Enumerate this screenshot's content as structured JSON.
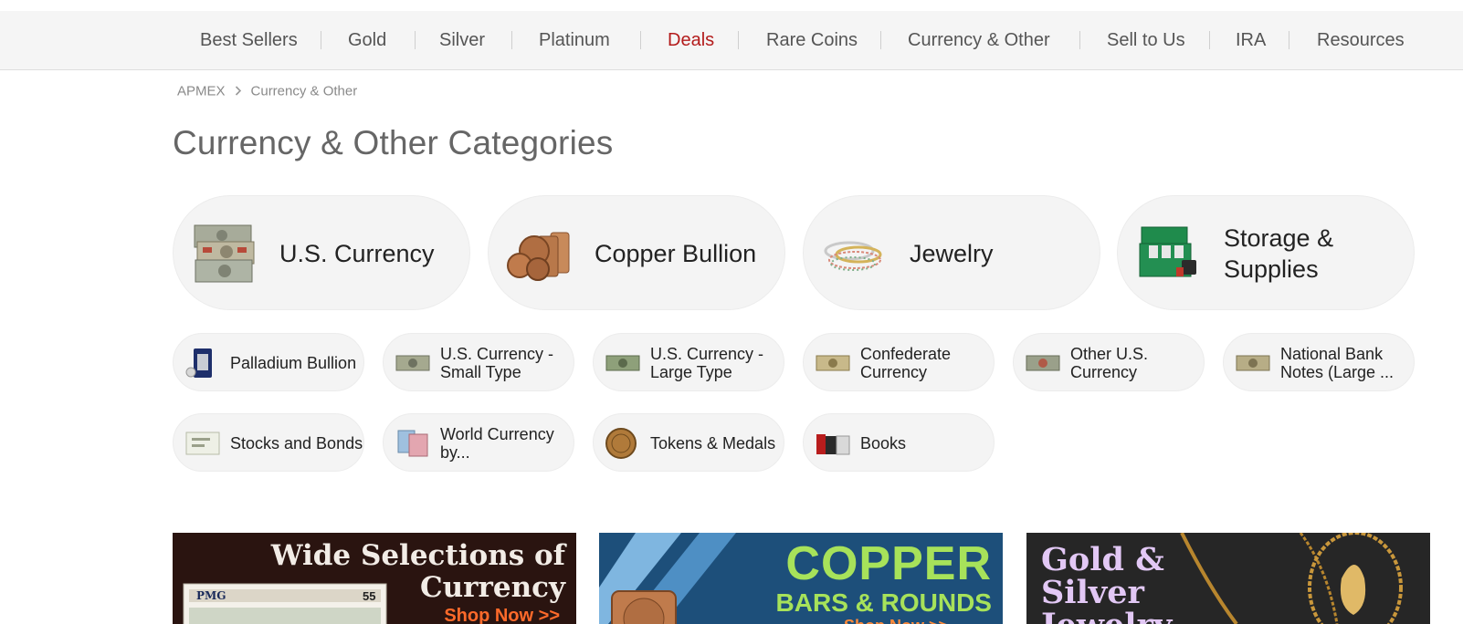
{
  "nav": {
    "items": [
      {
        "label": "Best Sellers",
        "color": "#555555"
      },
      {
        "label": "Gold",
        "color": "#555555"
      },
      {
        "label": "Silver",
        "color": "#555555"
      },
      {
        "label": "Platinum",
        "color": "#555555"
      },
      {
        "label": "Deals",
        "color": "#b31b1b"
      },
      {
        "label": "Rare Coins",
        "color": "#555555"
      },
      {
        "label": "Currency & Other",
        "color": "#555555"
      },
      {
        "label": "Sell to Us",
        "color": "#555555"
      },
      {
        "label": "IRA",
        "color": "#555555"
      },
      {
        "label": "Resources",
        "color": "#555555"
      }
    ]
  },
  "breadcrumb": {
    "home": "APMEX",
    "current": "Currency & Other",
    "separator_icon": "chevron-right-icon"
  },
  "page": {
    "title": "Currency & Other Categories"
  },
  "featured_categories": [
    {
      "label": "U.S. Currency",
      "icon": "banknotes-icon"
    },
    {
      "label": "Copper Bullion",
      "icon": "copper-bars-icon"
    },
    {
      "label": "Jewelry",
      "icon": "bracelets-icon"
    },
    {
      "label": "Storage & Supplies",
      "icon": "storage-box-icon"
    }
  ],
  "subcategories": [
    {
      "label": "Palladium Bullion",
      "icon": "palladium-bar-icon"
    },
    {
      "label": "U.S. Currency - Small Type",
      "icon": "banknote-icon"
    },
    {
      "label": "U.S. Currency - Large Type",
      "icon": "banknote-icon"
    },
    {
      "label": "Confederate Currency",
      "icon": "banknote-icon"
    },
    {
      "label": "Other U.S. Currency",
      "icon": "banknote-icon"
    },
    {
      "label": "National Bank Notes (Large ...",
      "icon": "banknote-icon"
    },
    {
      "label": "Stocks and Bonds",
      "icon": "certificate-icon"
    },
    {
      "label": "World Currency by...",
      "icon": "world-notes-icon"
    },
    {
      "label": "Tokens & Medals",
      "icon": "medal-icon"
    },
    {
      "label": "Books",
      "icon": "books-icon"
    }
  ],
  "banners": [
    {
      "headline": "Wide Selections of Currency",
      "cta": "Shop Now >>",
      "note_label": "PMG",
      "note_number": "55"
    },
    {
      "headline": "COPPER",
      "subheadline": "BARS & ROUNDS",
      "cta": "Shop Now >>"
    },
    {
      "headline": "Gold & Silver Jewelry"
    }
  ]
}
